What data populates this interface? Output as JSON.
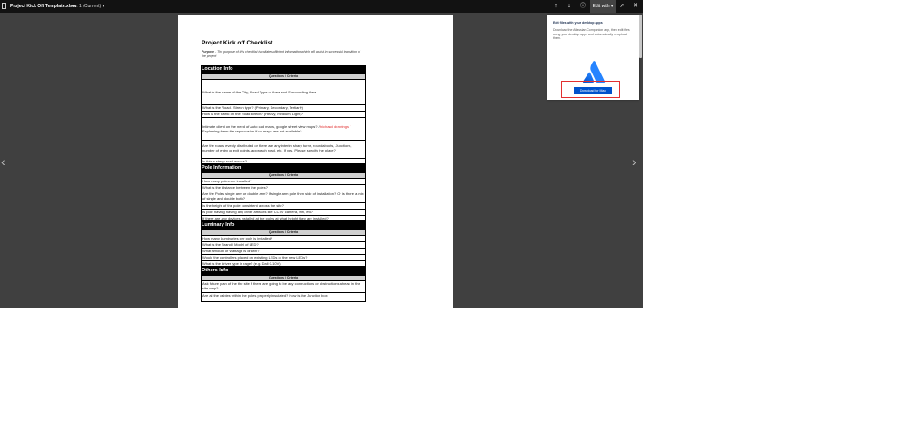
{
  "toolbar": {
    "file_title": "Project Kick Off Template.xlsm",
    "version": "• v. 1 (Current) ▾",
    "edit_with_label": "Edit with ▾"
  },
  "icons": {
    "file": "file-icon",
    "upload": "upload-icon",
    "download": "download-icon",
    "info": "info-icon",
    "open_external": "open-external-icon",
    "close": "close-icon",
    "prev": "chevron-left-icon",
    "next": "chevron-right-icon"
  },
  "document": {
    "title": "Project Kick off Checklist",
    "purpose_label": "Purpose",
    "purpose_text": " - The purpose of this checklist is collate sufficient information which will assist in successful transition of the project",
    "sections": [
      {
        "name": "Location Info",
        "header": "Questions / Criteria",
        "rows": [
          {
            "text": "What is the name of the City, Road Type of Area and Surrounding Area"
          },
          {
            "text": "What is the Road / Strech type? (Primary, Secondary, Tertiarly)"
          },
          {
            "text": "How is the traffic on the Road strech? (Heavy, medium, Light)?"
          },
          {
            "text": "Intimate client on the need of Auto cad maps, google street view maps? / ",
            "red": "hichand drawings / ",
            "rest": " Explaining them the repurcusion if no maps are not available?"
          },
          {
            "text": "Are the roads evenly distributed or there are any interim sharp turns, roundabouts, Junctions, number of entry or exit points, approach road, etc. If yes, Please specify the place?"
          },
          {
            "text": "Is this a steep road across?"
          }
        ]
      },
      {
        "name": "Pole Information",
        "header": "Questions / Criteria",
        "rows": [
          {
            "text": "How many poles are installed?"
          },
          {
            "text": "What is the distance between the poles?"
          },
          {
            "text": "Are the Poles single arm or double arm? If single arm pole then side of installation? Or is there a mix of single and double both?"
          },
          {
            "text": "Is the height of the pole consistent across the site?"
          },
          {
            "text": "Is pole having having any other artifacts like CCTV camera, wifi, etc?"
          },
          {
            "text": "If there are any devices installed at the poles at what height they are installed?"
          }
        ]
      },
      {
        "name": "Luminary Info",
        "header": "Questions / Criteria",
        "rows": [
          {
            "text": "How many Luminaries per pole is installed?"
          },
          {
            "text": "What is the Brand / Model of LED?"
          },
          {
            "text": "What amount of Wattage is drawn?"
          },
          {
            "text": "Would the controllers placed on exisiting LEDs or the new LEDs?"
          },
          {
            "text": "What is the driver type in rage? (e.g. Dali 0-10V)"
          }
        ]
      },
      {
        "name": "Others Info",
        "header": "Questions / Criteria",
        "rows": [
          {
            "text": "Ask future plan of the the site if there are going to be any contructions or obstructions ahead in the site map?"
          },
          {
            "text": "Are all the cables within the poles properly insulated? How is the Junction box"
          }
        ]
      }
    ]
  },
  "popup": {
    "heading": "Edit files with your desktop apps",
    "body": "Download the Atlassian Companion app, then edit files using your desktop apps and automatically re-upload them.",
    "button_label": "Download for Mac"
  },
  "colors": {
    "accent": "#0052cc",
    "highlight": "#e23030",
    "topbar": "#121212",
    "overlay": "#404040"
  }
}
